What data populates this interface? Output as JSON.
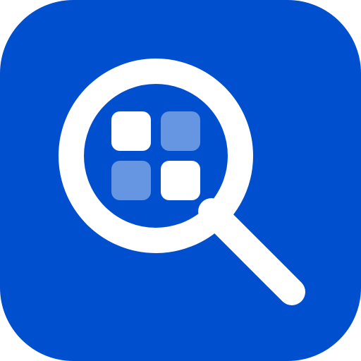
{
  "icon": {
    "name": "app-search-icon",
    "colors": {
      "background": "#004fcf",
      "foreground": "#ffffff",
      "tile_primary": "#ffffff",
      "tile_secondary": "#ffffff"
    },
    "tile_secondary_opacity": 0.4
  }
}
